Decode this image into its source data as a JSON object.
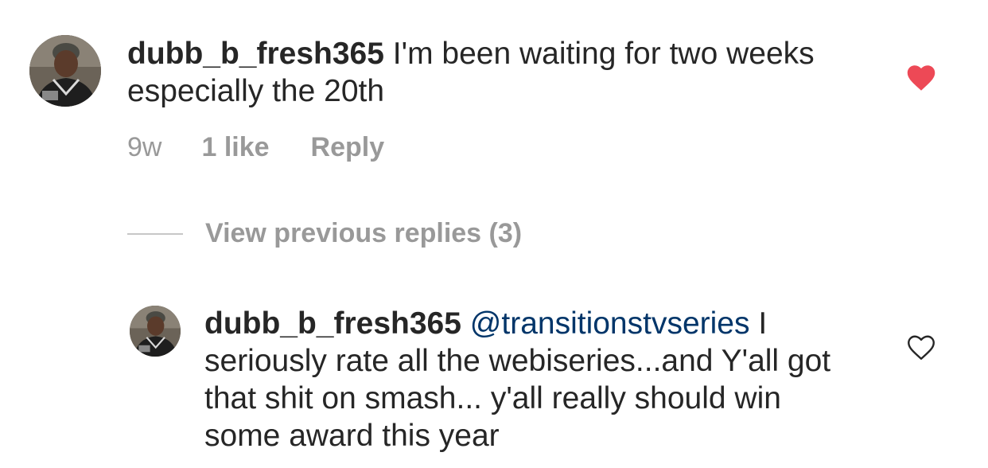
{
  "colors": {
    "text": "#262626",
    "muted": "#999999",
    "mention": "#003569",
    "heart_liked": "#ed4956",
    "heart_outline": "#262626"
  },
  "comment": {
    "username": "dubb_b_fresh365",
    "text": "I'm been waiting for two weeks especially the 20th",
    "age": "9w",
    "likes": "1 like",
    "reply_label": "Reply",
    "liked": true,
    "avatar_icon": "user-avatar",
    "like_icon": "heart-filled-icon"
  },
  "thread": {
    "view_replies_label": "View previous replies (3)"
  },
  "reply": {
    "username": "dubb_b_fresh365",
    "mention": "@transitionstvseries",
    "text": " I seriously rate all the webiseries...and Y'all got that shit on smash... y'all really should win some award this year",
    "liked": false,
    "avatar_icon": "user-avatar",
    "like_icon": "heart-outline-icon"
  }
}
